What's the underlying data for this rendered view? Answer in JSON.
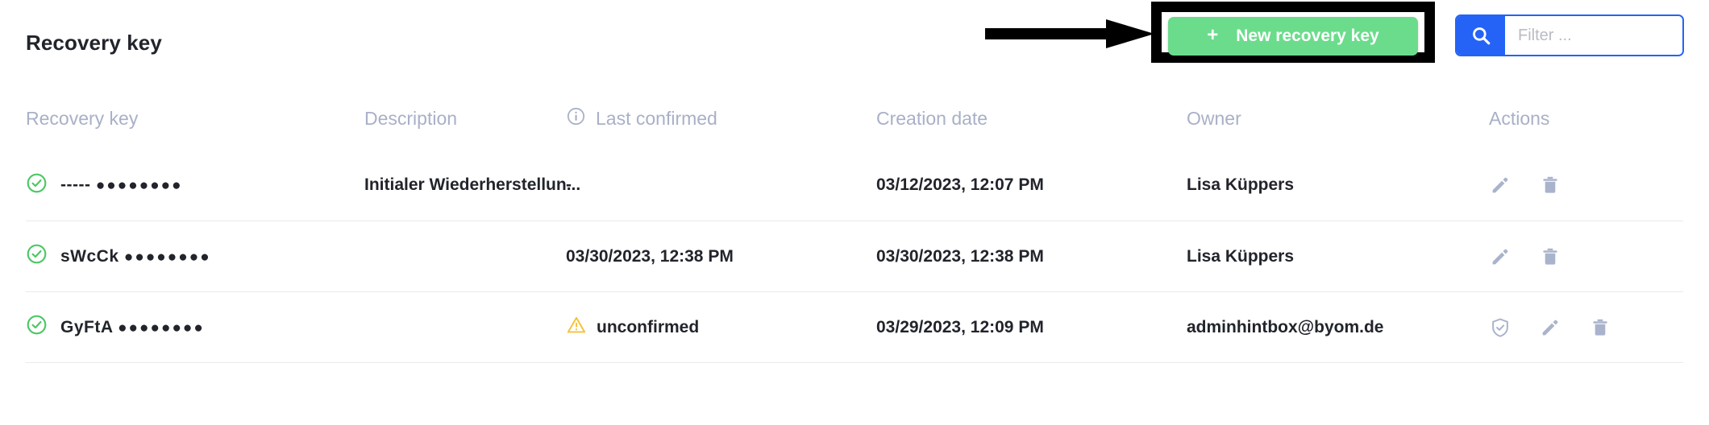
{
  "header": {
    "title": "Recovery key",
    "new_key_button": {
      "plus": "+",
      "label": "New recovery key"
    },
    "filter": {
      "placeholder": "Filter ...",
      "value": ""
    }
  },
  "colors": {
    "accent_green": "#6bdc8c",
    "accent_blue": "#2563f6",
    "header_text": "#a9b0c7",
    "icon_muted": "#a9b3cc",
    "warning": "#f5c237",
    "success": "#4cc764"
  },
  "table": {
    "columns": [
      {
        "key": "recovery_key",
        "label": "Recovery key",
        "icon": null
      },
      {
        "key": "description",
        "label": "Description",
        "icon": null
      },
      {
        "key": "last_confirmed",
        "label": "Last confirmed",
        "icon": "info-icon"
      },
      {
        "key": "creation_date",
        "label": "Creation date",
        "icon": null
      },
      {
        "key": "owner",
        "label": "Owner",
        "icon": null
      },
      {
        "key": "actions",
        "label": "Actions",
        "icon": null
      }
    ],
    "rows": [
      {
        "status_icon": "check-circle-icon",
        "recovery_key_prefix": "-----",
        "recovery_key_dots": "●●●●●●●●",
        "description": "Initialer Wiederherstellun...",
        "last_confirmed": "-",
        "last_confirmed_icon": null,
        "creation_date": "03/12/2023, 12:07 PM",
        "owner": "Lisa Küppers",
        "actions": [
          "edit-icon",
          "delete-icon"
        ]
      },
      {
        "status_icon": "check-circle-icon",
        "recovery_key_prefix": "sWcCk",
        "recovery_key_dots": "●●●●●●●●",
        "description": "",
        "last_confirmed": "03/30/2023, 12:38 PM",
        "last_confirmed_icon": null,
        "creation_date": "03/30/2023, 12:38 PM",
        "owner": "Lisa Küppers",
        "actions": [
          "edit-icon",
          "delete-icon"
        ]
      },
      {
        "status_icon": "check-circle-icon",
        "recovery_key_prefix": "GyFtA",
        "recovery_key_dots": "●●●●●●●●",
        "description": "",
        "last_confirmed": "unconfirmed",
        "last_confirmed_icon": "warning-icon",
        "creation_date": "03/29/2023, 12:09 PM",
        "owner": "adminhintbox@byom.de",
        "actions": [
          "shield-check-icon",
          "edit-icon",
          "delete-icon"
        ]
      }
    ]
  }
}
